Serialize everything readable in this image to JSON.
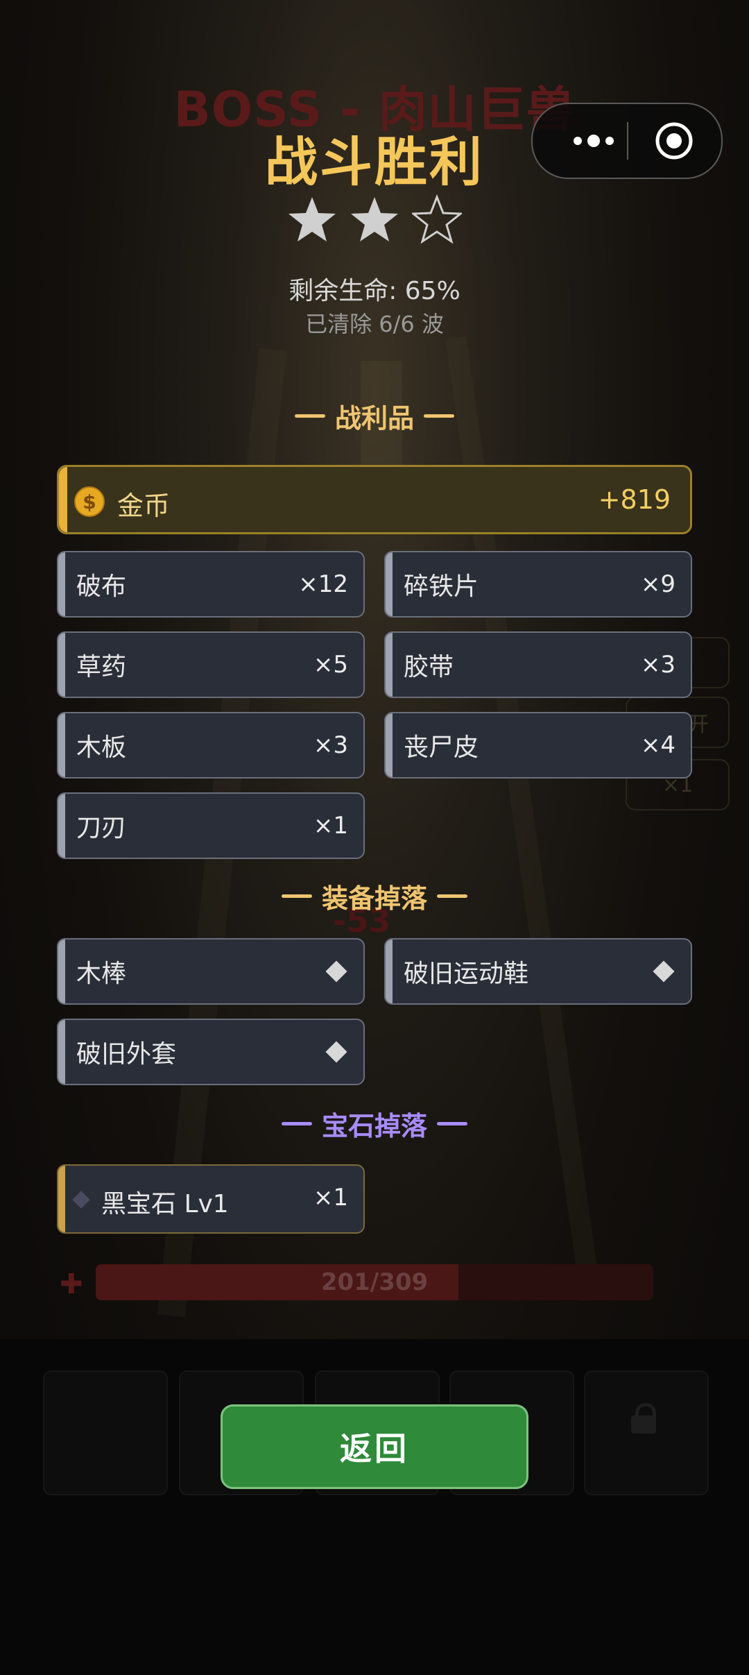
{
  "background": {
    "boss_name": "BOSS - 肉山巨兽",
    "hp_text": "201/309",
    "hp_fraction": 0.65,
    "damage_text": "-53",
    "side_buttons": [
      "",
      "自动开",
      "×1"
    ]
  },
  "capsule": {
    "menu_icon": "more-dots-icon",
    "close_icon": "target-icon"
  },
  "result": {
    "title": "战斗胜利",
    "stars_total": 3,
    "stars_earned": 2,
    "hp_remaining": "剩余生命: 65%",
    "waves_cleared": "已清除 6/6 波"
  },
  "loot": {
    "title": "战利品",
    "gold": {
      "name": "金币",
      "amount": "+819",
      "icon_text": "$"
    },
    "items": [
      {
        "name": "破布",
        "qty": "×12"
      },
      {
        "name": "碎铁片",
        "qty": "×9"
      },
      {
        "name": "草药",
        "qty": "×5"
      },
      {
        "name": "胶带",
        "qty": "×3"
      },
      {
        "name": "木板",
        "qty": "×3"
      },
      {
        "name": "丧尸皮",
        "qty": "×4"
      },
      {
        "name": "刀刃",
        "qty": "×1"
      }
    ]
  },
  "equipment": {
    "title": "装备掉落",
    "items": [
      {
        "name": "木棒"
      },
      {
        "name": "破旧运动鞋"
      },
      {
        "name": "破旧外套"
      }
    ]
  },
  "gems": {
    "title": "宝石掉落",
    "items": [
      {
        "name": "黑宝石 Lv1",
        "qty": "×1"
      }
    ]
  },
  "actions": {
    "return_label": "返回"
  },
  "colors": {
    "title": "#f5c75a",
    "loot_title": "#f0c570",
    "equipment_title": "#f0c570",
    "gem_title": "#a88cff",
    "gold_accent": "#e9b23a",
    "button_green": "#2f8a3a"
  }
}
